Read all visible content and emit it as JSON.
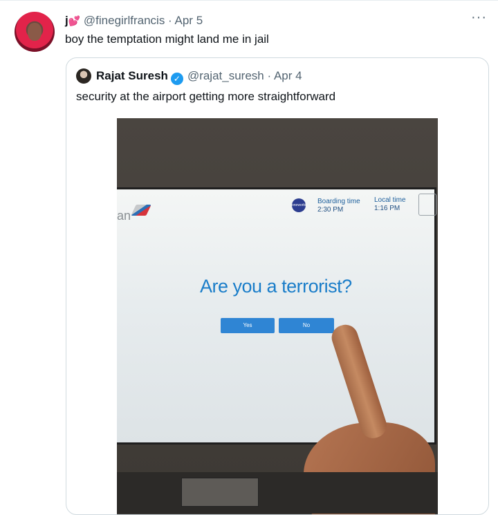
{
  "tweet": {
    "name": "j",
    "name_emoji": "💕",
    "handle": "@finegirlfrancis",
    "separator": "·",
    "date": "Apr 5",
    "text": "boy the temptation might land me in jail",
    "more_label": "···"
  },
  "quoted": {
    "name": "Rajat Suresh",
    "handle": "@rajat_suresh",
    "separator": "·",
    "date": "Apr 4",
    "text": "security at the airport getting more straightforward",
    "verified_icon": "✓"
  },
  "kiosk": {
    "brand_fragment": "an",
    "oneworld": "oneworld",
    "boarding_label": "Boarding time",
    "boarding_value": "2:30 PM",
    "local_label": "Local time",
    "local_value": "1:16 PM",
    "question": "Are you a terrorist?",
    "yes_label": "Yes",
    "no_label": "No"
  },
  "colors": {
    "accent": "#1d9bf0",
    "kiosk_text": "#1a7dc9",
    "kiosk_button": "#2f85d4"
  }
}
